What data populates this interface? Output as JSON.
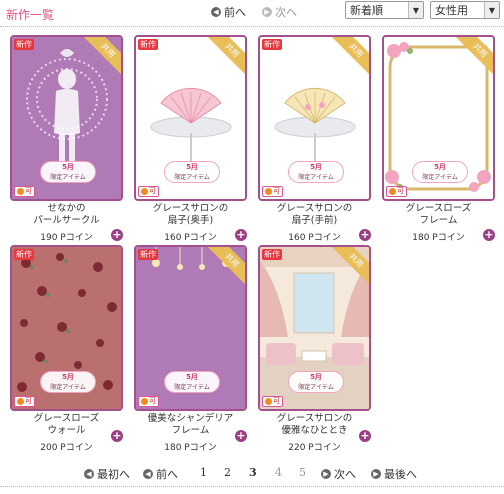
{
  "header": {
    "title": "新作一覧",
    "prev_label": "前へ",
    "next_label": "次へ",
    "sort_select": "新着順",
    "gender_select": "女性用"
  },
  "badges": {
    "new": "新作",
    "shared": "共用",
    "allowed": "可",
    "limited_month": "5月",
    "limited_label": "限定アイテム"
  },
  "items": [
    {
      "name_line1": "せなかの",
      "name_line2": "パールサークル",
      "price": "190 Pコイン"
    },
    {
      "name_line1": "グレースサロンの",
      "name_line2": "扇子(奥手)",
      "price": "160 Pコイン"
    },
    {
      "name_line1": "グレースサロンの",
      "name_line2": "扇子(手前)",
      "price": "160 Pコイン"
    },
    {
      "name_line1": "グレースローズ",
      "name_line2": "フレーム",
      "price": "180 Pコイン"
    },
    {
      "name_line1": "グレースローズ",
      "name_line2": "ウォール",
      "price": "200 Pコイン"
    },
    {
      "name_line1": "優美なシャンデリア",
      "name_line2": "フレーム",
      "price": "180 Pコイン"
    },
    {
      "name_line1": "グレースサロンの",
      "name_line2": "優雅なひととき",
      "price": "220 Pコイン"
    }
  ],
  "pagination": {
    "first_label": "最初へ",
    "prev_label": "前へ",
    "pages": [
      "1",
      "2",
      "3",
      "4",
      "5"
    ],
    "current_page": "3",
    "next_label": "次へ",
    "last_label": "最後へ"
  },
  "colors": {
    "accent_pink": "#e8557d",
    "card_border": "#a2508e",
    "new_badge": "#e8383d",
    "shared_ribbon": "#e9bd57",
    "plus_button": "#9a3f83"
  }
}
